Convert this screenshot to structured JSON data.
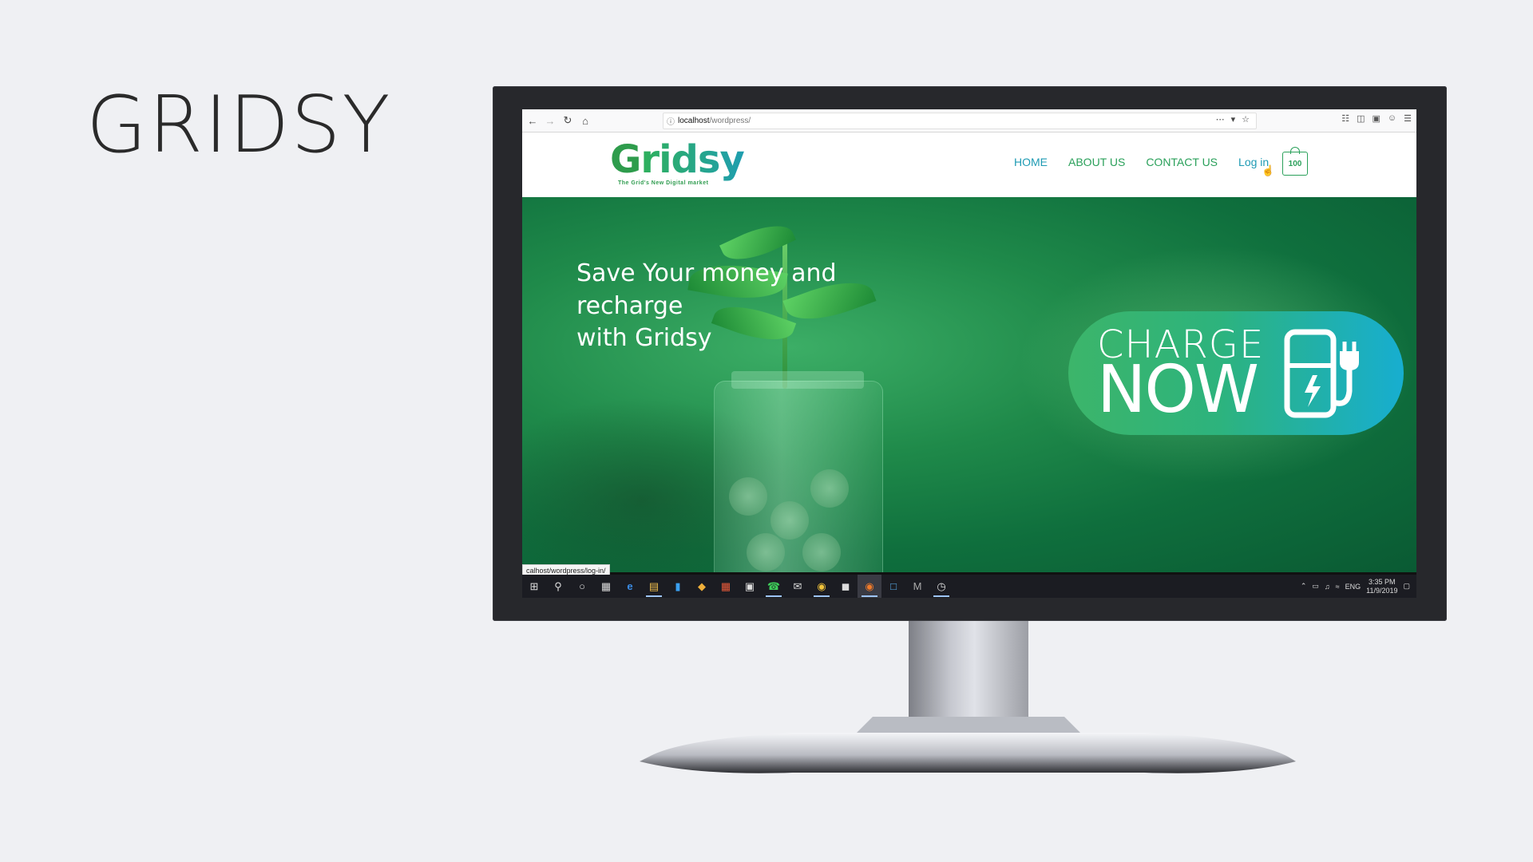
{
  "slide": {
    "title": "GRIDSY"
  },
  "browser": {
    "url_host": "localhost",
    "url_path": "/wordpress/",
    "status_url": "calhost/wordpress/log-in/"
  },
  "site": {
    "logo_text_first": "G",
    "logo_text_rest": "ridsy",
    "logo_tagline": "The Grid's New Digital market",
    "nav": {
      "home": "HOME",
      "about": "ABOUT US",
      "contact": "CONTACT US",
      "login": "Log in"
    },
    "cart_count": "100",
    "hero_text_line1": "Save Your money and recharge",
    "hero_text_line2": "with Gridsy",
    "cta_top": "CHARGE",
    "cta_bottom": "NOW"
  },
  "taskbar": {
    "lang": "ENG",
    "time": "3:35 PM",
    "date": "11/9/2019"
  },
  "colors": {
    "brand_green": "#2aa05a",
    "brand_teal": "#1f9bb4",
    "background": "#eff0f3"
  }
}
